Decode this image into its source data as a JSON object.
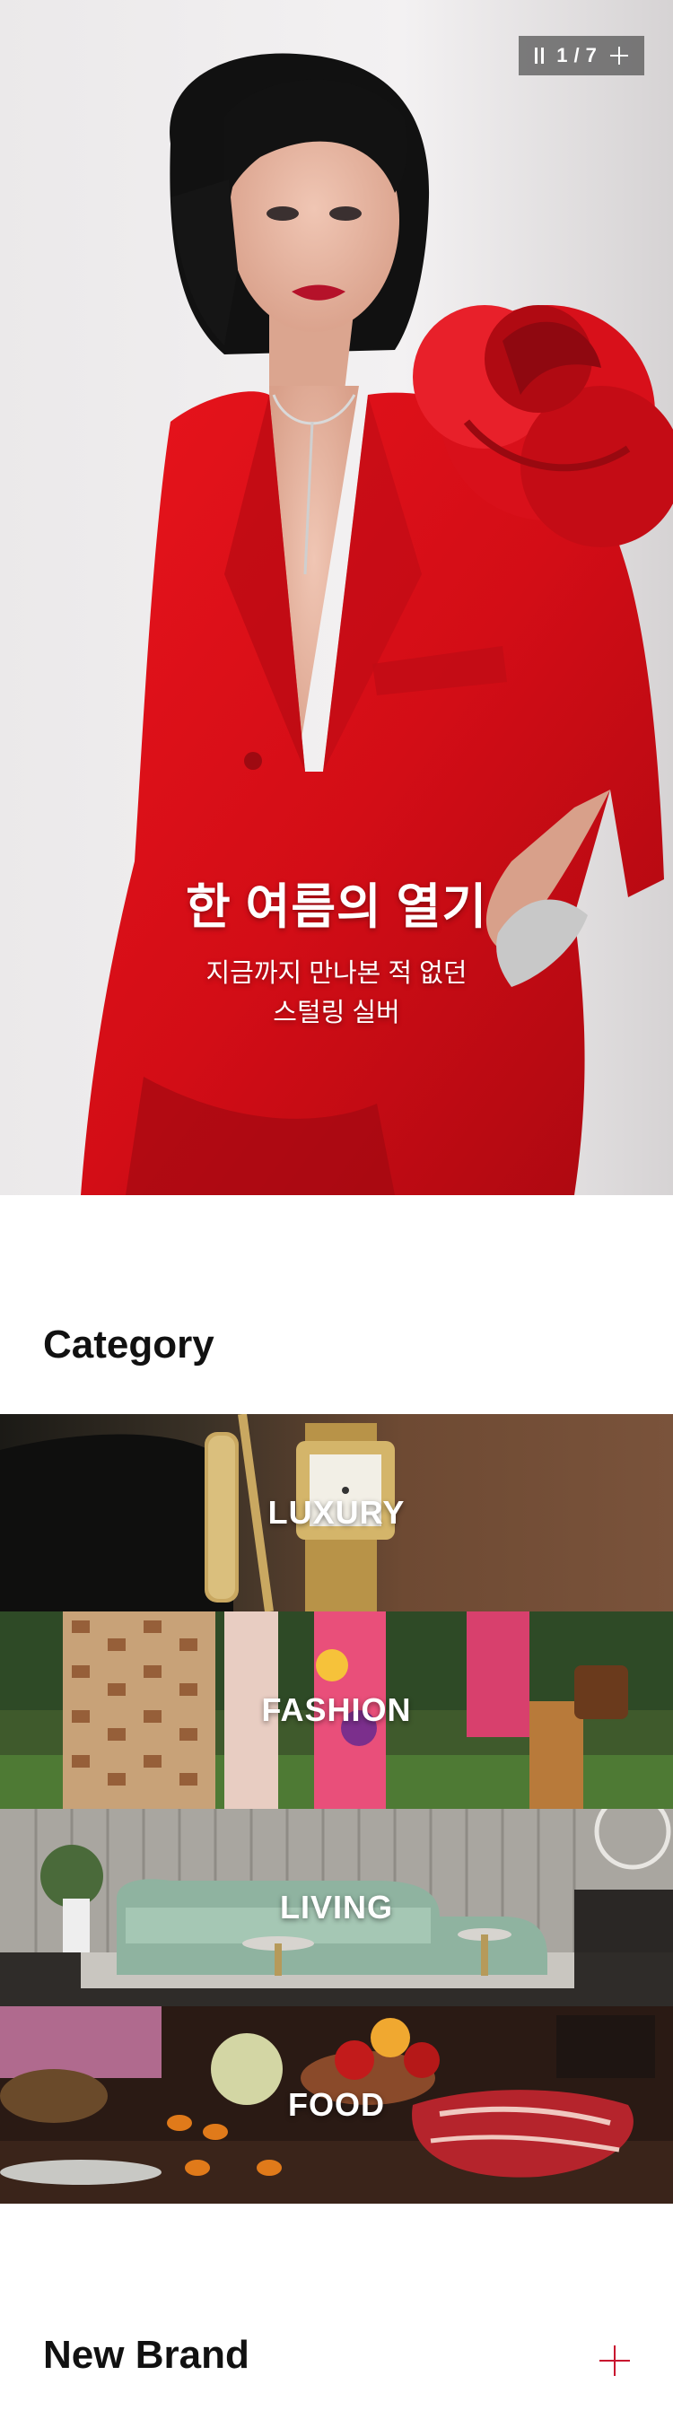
{
  "hero": {
    "counter_current": "1",
    "counter_separator": "/",
    "counter_total": "7",
    "title": "한 여름의 열기",
    "subtitle_line1": "지금까지 만나본 적 없던",
    "subtitle_line2": "스털링 실버",
    "pause_icon": "pause-icon",
    "expand_icon": "plus-icon"
  },
  "category": {
    "title": "Category",
    "items": [
      {
        "label": "LUXURY"
      },
      {
        "label": "FASHION"
      },
      {
        "label": "LIVING"
      },
      {
        "label": "FOOD"
      }
    ]
  },
  "new_brand": {
    "title": "New Brand",
    "more_icon": "plus-icon",
    "accent_color": "#c8102e"
  }
}
